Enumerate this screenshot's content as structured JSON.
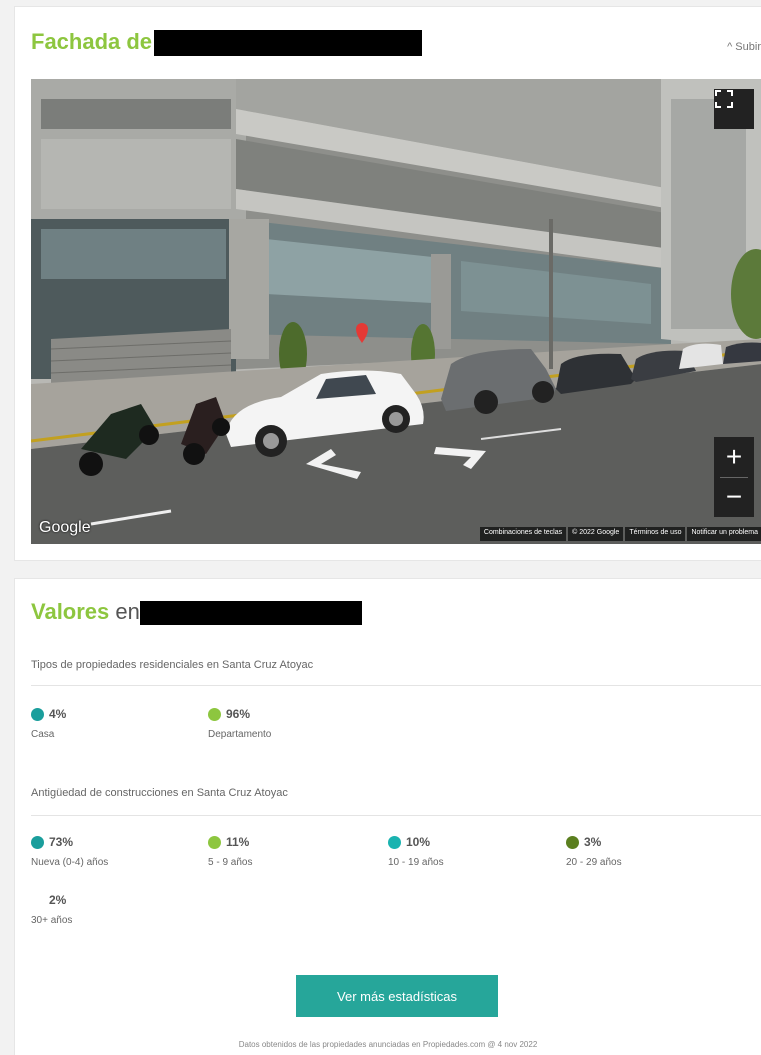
{
  "fachada": {
    "title_prefix": "Fachada de",
    "collapse_label": "^ Subir"
  },
  "streetview": {
    "google_logo": "Google",
    "attribution": [
      "Combinaciones de teclas",
      "© 2022 Google",
      "Términos de uso",
      "Notificar un problema"
    ],
    "zoom_in": "+",
    "zoom_out": "−"
  },
  "valores": {
    "title_prefix": "Valores",
    "title_suffix": "en",
    "tipos_title": "Tipos de propiedades residenciales en Santa Cruz Atoyac",
    "tipos": [
      {
        "pct": "4%",
        "label": "Casa",
        "color": "#1a9e9c"
      },
      {
        "pct": "96%",
        "label": "Departamento",
        "color": "#8dc63f"
      }
    ],
    "antig_title": "Antigüedad de construcciones en Santa Cruz Atoyac",
    "antig": [
      {
        "pct": "73%",
        "label": "Nueva (0-4) años",
        "color": "#1a9e9c"
      },
      {
        "pct": "11%",
        "label": "5 - 9 años",
        "color": "#8dc63f"
      },
      {
        "pct": "10%",
        "label": "10 - 19 años",
        "color": "#1ab3b0"
      },
      {
        "pct": "3%",
        "label": "20 - 29 años",
        "color": "#5b7f1f"
      },
      {
        "pct": "2%",
        "label": "30+ años"
      }
    ],
    "button_label": "Ver más estadísticas",
    "footnote": "Datos obtenidos de las propiedades anunciadas en Propiedades.com @ 4 nov 2022"
  }
}
